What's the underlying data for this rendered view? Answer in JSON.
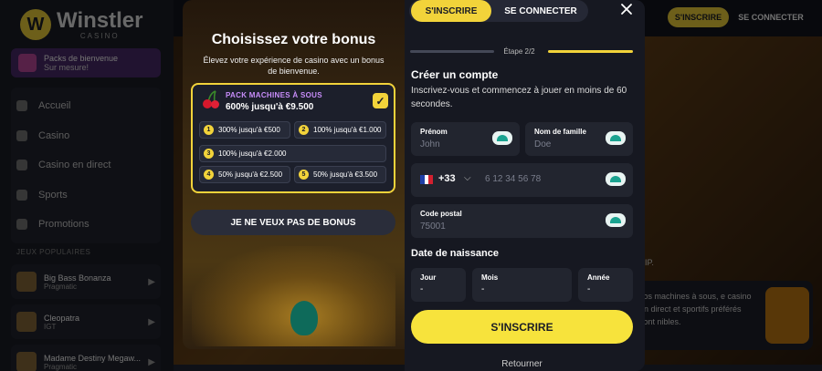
{
  "background": {
    "brand": {
      "name": "Winstler",
      "sub": "CASINO"
    },
    "promo": {
      "title": "Packs de bienvenue",
      "subtitle": "Sur mesure!"
    },
    "nav": [
      "Accueil",
      "Casino",
      "Casino en direct",
      "Sports",
      "Promotions"
    ],
    "section_label": "JEUX POPULAIRES",
    "games": [
      {
        "name": "Big Bass Bonanza",
        "provider": "Pragmatic"
      },
      {
        "name": "Cleopatra",
        "provider": "IGT"
      },
      {
        "name": "Madame Destiny Megaw...",
        "provider": "Pragmatic"
      }
    ],
    "header": {
      "signup": "S'INSCRIRE",
      "login": "SE CONNECTER"
    },
    "vip_text": "VIP.",
    "promo_text": "vos machines à sous, e casino en direct et sportifs préférés sont nibles."
  },
  "bonus": {
    "title": "Choisissez votre bonus",
    "subtitle": "Élevez votre expérience de casino avec un bonus de bienvenue.",
    "selected": {
      "tag": "PACK MACHINES À SOUS",
      "amount": "600% jusqu'à €9.500"
    },
    "options": [
      {
        "num": "1",
        "text": "300% jusqu'à €500"
      },
      {
        "num": "2",
        "text": "100% jusqu'à €1.000"
      },
      {
        "num": "3",
        "text": "100% jusqu'à €2.000"
      },
      {
        "num": "4",
        "text": "50% jusqu'à €2.500"
      },
      {
        "num": "5",
        "text": "50% jusqu'à €3.500"
      }
    ],
    "no_bonus": "JE NE VEUX PAS DE BONUS"
  },
  "form": {
    "tabs": {
      "signup": "S'INSCRIRE",
      "login": "SE CONNECTER"
    },
    "step": "Étape 2/2",
    "title": "Créer un compte",
    "subtitle": "Inscrivez-vous et commencez à jouer en moins de 60 secondes.",
    "first_name": {
      "label": "Prénom",
      "placeholder": "John"
    },
    "last_name": {
      "label": "Nom de famille",
      "placeholder": "Doe"
    },
    "phone": {
      "code": "+33",
      "placeholder": "6 12 34 56 78"
    },
    "postal": {
      "label": "Code postal",
      "placeholder": "75001"
    },
    "dob_label": "Date de naissance",
    "dob": [
      {
        "label": "Jour",
        "value": "-"
      },
      {
        "label": "Mois",
        "value": "-"
      },
      {
        "label": "Année",
        "value": "-"
      }
    ],
    "submit": "S'INSCRIRE",
    "back": "Retourner"
  },
  "colors": {
    "accent": "#f2d33a",
    "panel": "#161821",
    "card": "#1c1f2b",
    "tag": "#c88dfa"
  }
}
